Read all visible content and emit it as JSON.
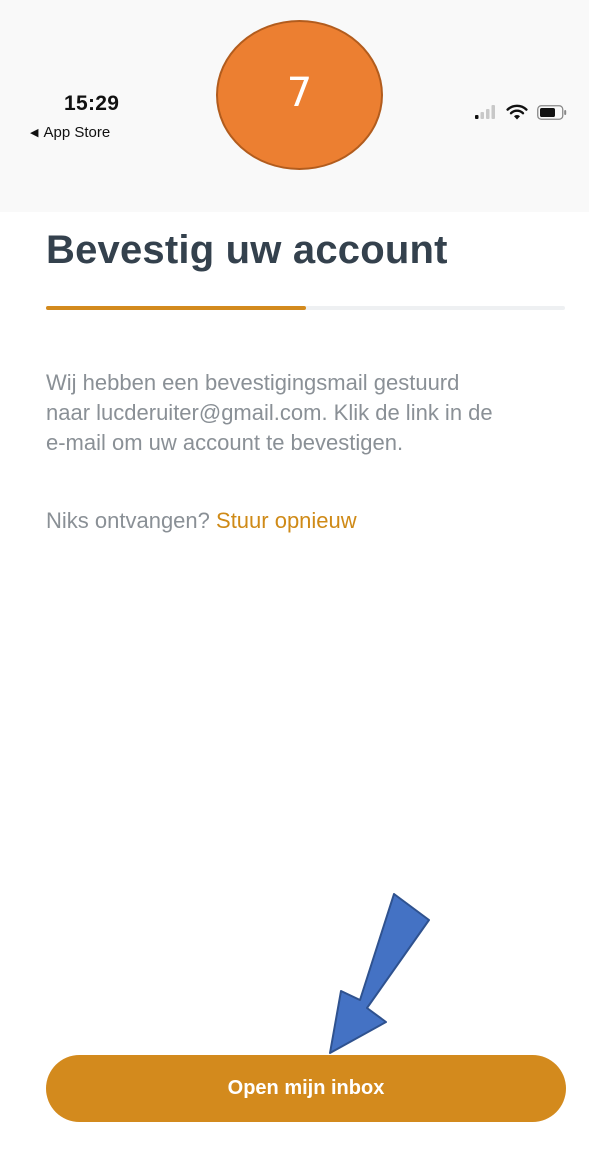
{
  "status_bar": {
    "time": "15:29",
    "back_label": "App Store",
    "back_glyph": "◀",
    "signal_icon": "cellular-signal-icon",
    "wifi_icon": "wifi-icon",
    "battery_icon": "battery-icon"
  },
  "step_badge": {
    "number": "7",
    "color": "#ec7f31"
  },
  "page": {
    "title": "Bevestig uw account",
    "progress_fraction": 0.5,
    "message_lines": [
      "Wij hebben een bevestigingsmail gestuurd",
      "naar lucderuiter@gmail.com. Klik de link in de",
      "e-mail om uw account te bevestigen."
    ],
    "resend_prompt": "Niks ontvangen?",
    "resend_link": "Stuur opnieuw"
  },
  "primary_button": {
    "label": "Open mijn inbox"
  },
  "colors": {
    "accent": "#d38a1d",
    "title": "#34414d",
    "body_text": "#8a9096",
    "annotation_arrow": "#4472c4"
  }
}
